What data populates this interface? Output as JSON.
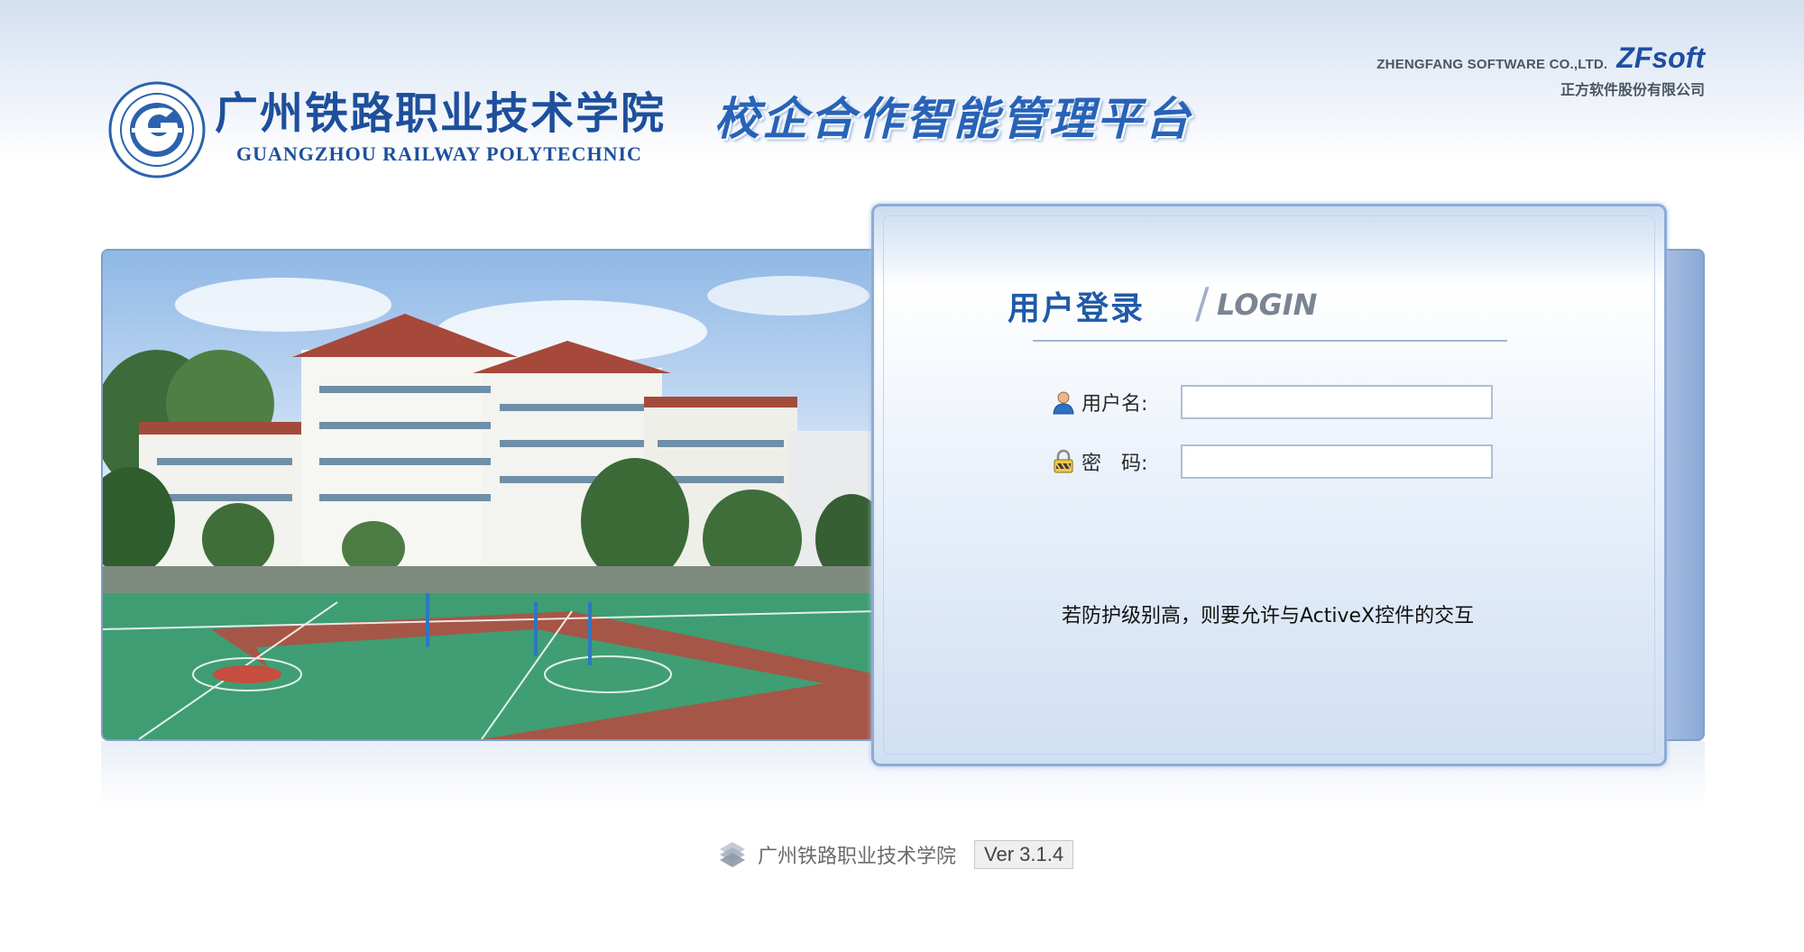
{
  "header": {
    "vendor_en": "ZHENGFANG SOFTWARE CO.,LTD.",
    "vendor_brand": "ZFsoft",
    "vendor_cn": "正方软件股份有限公司",
    "school_cn": "广州铁路职业技术学院",
    "school_en": "GUANGZHOU RAILWAY POLYTECHNIC",
    "platform_title": "校企合作智能管理平台"
  },
  "login": {
    "title": "用户登录",
    "subtitle": "LOGIN",
    "username_label": "用户名:",
    "username_value": "",
    "password_label": "密　码:",
    "password_value": "",
    "activex_note": "若防护级别高，则要允许与ActiveX控件的交互"
  },
  "footer": {
    "school_name": "广州铁路职业技术学院",
    "version": "Ver 3.1.4"
  },
  "icons": {
    "user": "user-icon",
    "lock": "lock-icon",
    "footer": "zf-logo-icon"
  },
  "colors": {
    "brand_blue": "#1f5aa8",
    "panel_border": "#8eabd6"
  }
}
